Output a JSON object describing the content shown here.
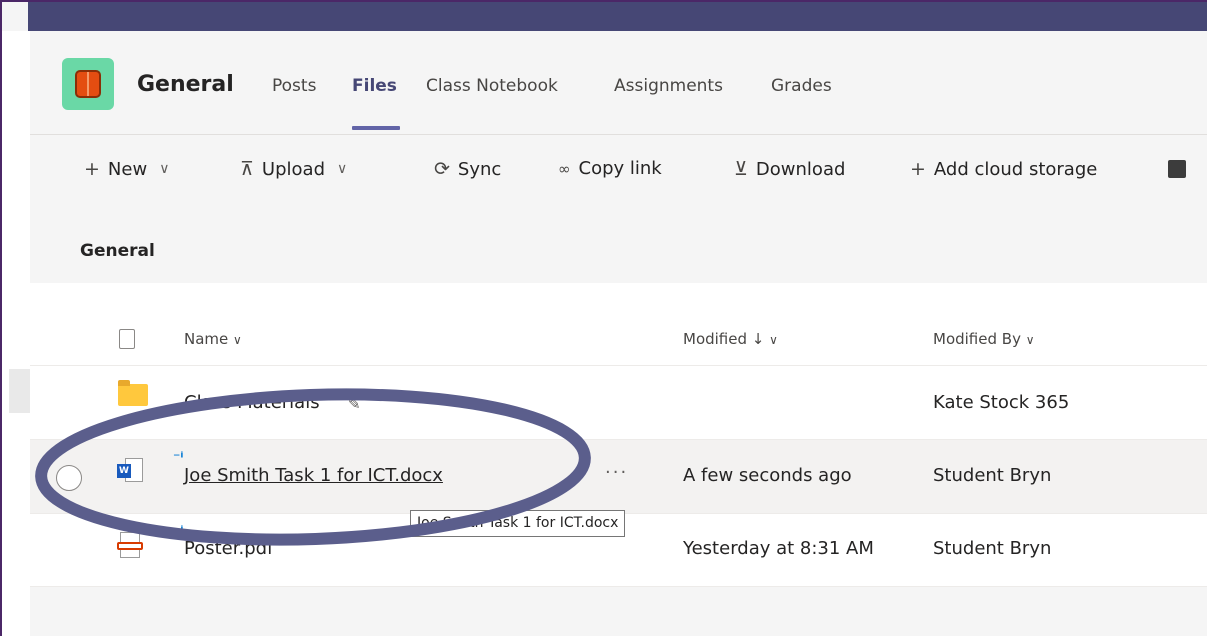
{
  "header": {
    "channel_name": "General",
    "tabs": [
      {
        "label": "Posts",
        "active": false
      },
      {
        "label": "Files",
        "active": true
      },
      {
        "label": "Class Notebook",
        "active": false
      },
      {
        "label": "Assignments",
        "active": false
      },
      {
        "label": "Grades",
        "active": false
      }
    ]
  },
  "toolbar": {
    "new_label": "New",
    "upload_label": "Upload",
    "sync_label": "Sync",
    "copy_link_label": "Copy link",
    "download_label": "Download",
    "add_cloud_label": "Add cloud storage"
  },
  "breadcrumb": "General",
  "columns": {
    "name": "Name",
    "modified": "Modified",
    "modified_by": "Modified By"
  },
  "rows": [
    {
      "name": "Class Materials",
      "modified": "",
      "modified_by": "Kate Stock 365"
    },
    {
      "name": "Joe Smith Task 1 for ICT.docx",
      "modified": "A few seconds ago",
      "modified_by": "Student Bryn"
    },
    {
      "name": "Poster.pdf",
      "modified": "Yesterday at 8:31 AM",
      "modified_by": "Student Bryn"
    }
  ],
  "tooltip": "Joe Smith Task 1 for ICT.docx",
  "colors": {
    "accent": "#6264a7",
    "top_bar": "#464775",
    "annotation_ellipse": "#5b5e8c"
  }
}
